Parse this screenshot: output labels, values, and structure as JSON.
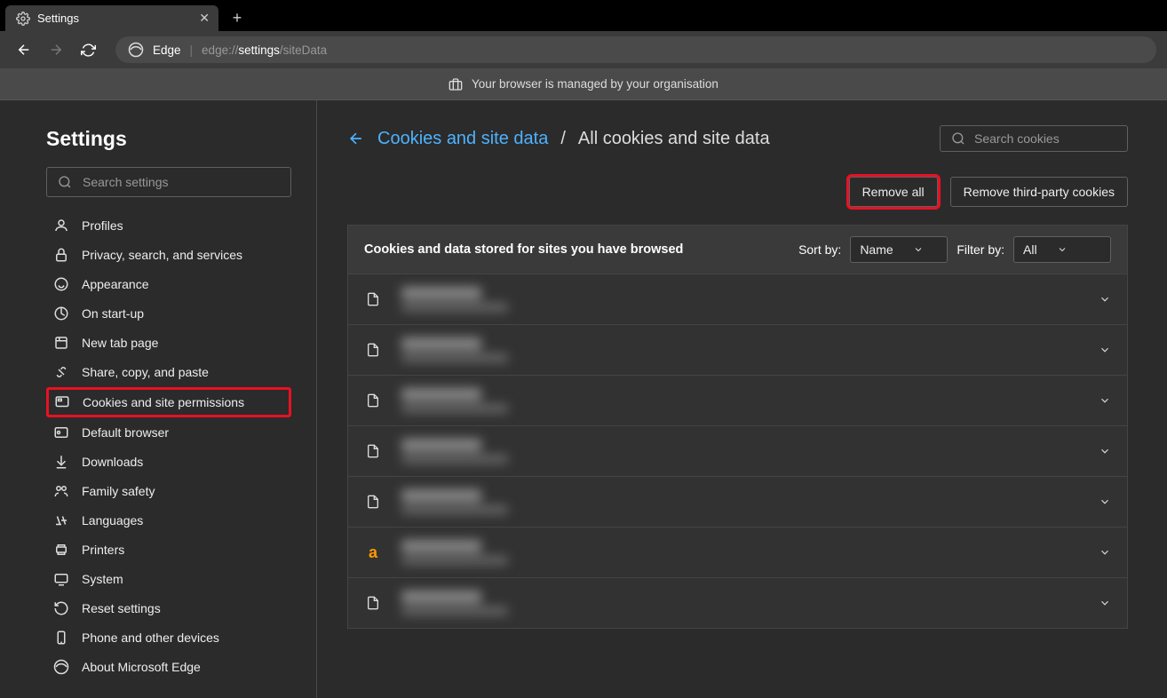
{
  "tab": {
    "title": "Settings"
  },
  "nav": {
    "edge_label": "Edge",
    "url_dim1": "edge://",
    "url_bright": "settings",
    "url_dim2": "/siteData"
  },
  "infobar": {
    "text": "Your browser is managed by your organisation"
  },
  "sidebar": {
    "title": "Settings",
    "search_placeholder": "Search settings",
    "items": [
      {
        "label": "Profiles"
      },
      {
        "label": "Privacy, search, and services"
      },
      {
        "label": "Appearance"
      },
      {
        "label": "On start-up"
      },
      {
        "label": "New tab page"
      },
      {
        "label": "Share, copy, and paste"
      },
      {
        "label": "Cookies and site permissions"
      },
      {
        "label": "Default browser"
      },
      {
        "label": "Downloads"
      },
      {
        "label": "Family safety"
      },
      {
        "label": "Languages"
      },
      {
        "label": "Printers"
      },
      {
        "label": "System"
      },
      {
        "label": "Reset settings"
      },
      {
        "label": "Phone and other devices"
      },
      {
        "label": "About Microsoft Edge"
      }
    ]
  },
  "content": {
    "bc_link": "Cookies and site data",
    "bc_sep": "/",
    "bc_current": "All cookies and site data",
    "search_placeholder": "Search cookies",
    "remove_all": "Remove all",
    "remove_third": "Remove third-party cookies",
    "table_title": "Cookies and data stored for sites you have browsed",
    "sort_label": "Sort by:",
    "sort_value": "Name",
    "filter_label": "Filter by:",
    "filter_value": "All"
  }
}
